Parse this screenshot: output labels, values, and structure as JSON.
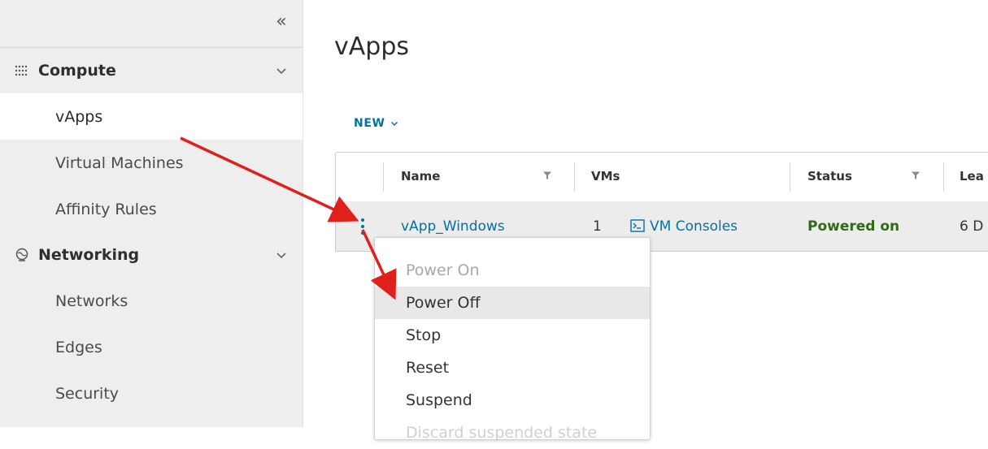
{
  "sidebar": {
    "collapse_icon": "double-chevron-left-icon",
    "collapse_glyph": "«",
    "groups": [
      {
        "label": "Compute",
        "icon": "grid-dots-icon",
        "items": [
          {
            "label": "vApps",
            "active": true
          },
          {
            "label": "Virtual Machines"
          },
          {
            "label": "Affinity Rules"
          }
        ]
      },
      {
        "label": "Networking",
        "icon": "globe-icon",
        "items": [
          {
            "label": "Networks"
          },
          {
            "label": "Edges"
          },
          {
            "label": "Security"
          }
        ]
      }
    ]
  },
  "main": {
    "title": "vApps",
    "new_button": "NEW",
    "grid": {
      "columns": [
        "Name",
        "VMs",
        "Status",
        "Lea"
      ],
      "rows": [
        {
          "name": "vApp_Windows",
          "vm_count": "1",
          "vm_consoles": "VM Consoles",
          "status": "Powered on",
          "lease": "6 D"
        }
      ]
    }
  },
  "context_menu": {
    "items": [
      {
        "label": "Power On",
        "state": "disabled"
      },
      {
        "label": "Power Off",
        "state": "hovered"
      },
      {
        "label": "Stop",
        "state": "normal"
      },
      {
        "label": "Reset",
        "state": "normal"
      },
      {
        "label": "Suspend",
        "state": "normal"
      },
      {
        "label": "Discard suspended state",
        "state": "faded"
      }
    ]
  },
  "colors": {
    "link": "#0072a3",
    "status_on": "#2f6b12",
    "arrow": "#e0201b",
    "sidebar_bg": "#eeeeee"
  }
}
